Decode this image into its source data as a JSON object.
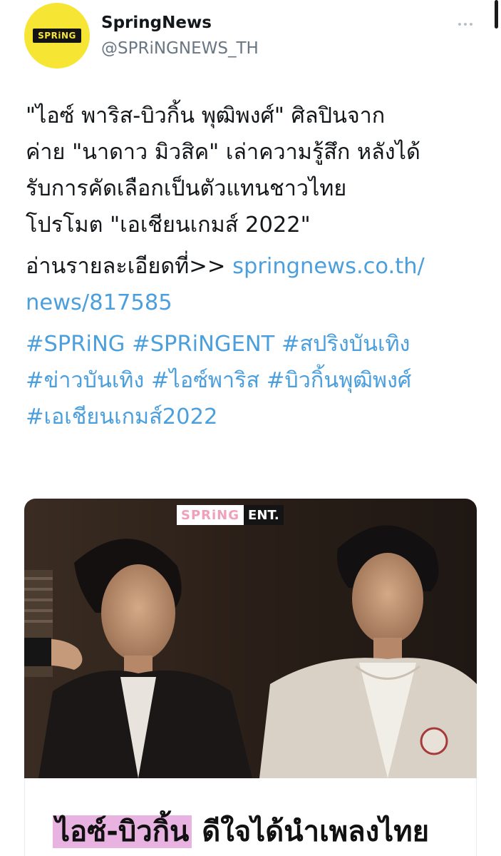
{
  "profile": {
    "display_name": "SpringNews",
    "handle": "@SPRiNGNEWS_TH",
    "avatar_logo_text": "SPRiNG"
  },
  "tweet": {
    "lines": [
      "\"ไอซ์ พาริส-บิวกิ้น พุฒิพงศ์\" ศิลปินจาก",
      "ค่าย \"นาดาว มิวสิค\" เล่าความรู้สึก หลังได้",
      "รับการคัดเลือกเป็นตัวแทนชาวไทย",
      "โปรโมต \"เอเชียนเกมส์ 2022\""
    ],
    "read_more_prefix": "อ่านรายละเอียดที่>> ",
    "link_line1": "springnews.co.th/",
    "link_line2": "news/817585",
    "hashtag_lines": [
      [
        "#SPRiNG",
        "#SPRiNGENT",
        "#สปริงบันเทิง"
      ],
      [
        "#ข่าวบันเทิง",
        "#ไอซ์พาริส",
        "#บิวกิ้นพุฒิพงศ์"
      ],
      [
        "#เอเชียนเกมส์2022"
      ]
    ]
  },
  "media": {
    "logo_left": "SPRiNG",
    "logo_right": "ENT.",
    "headline_highlight": "ไอซ์-บิวกิ้น",
    "headline_rest": " ดีใจได้นำเพลงไทย"
  },
  "colors": {
    "link": "#4b9fdc",
    "avatar_bg": "#f7e533",
    "text": "#14171a",
    "handle": "#687684"
  }
}
